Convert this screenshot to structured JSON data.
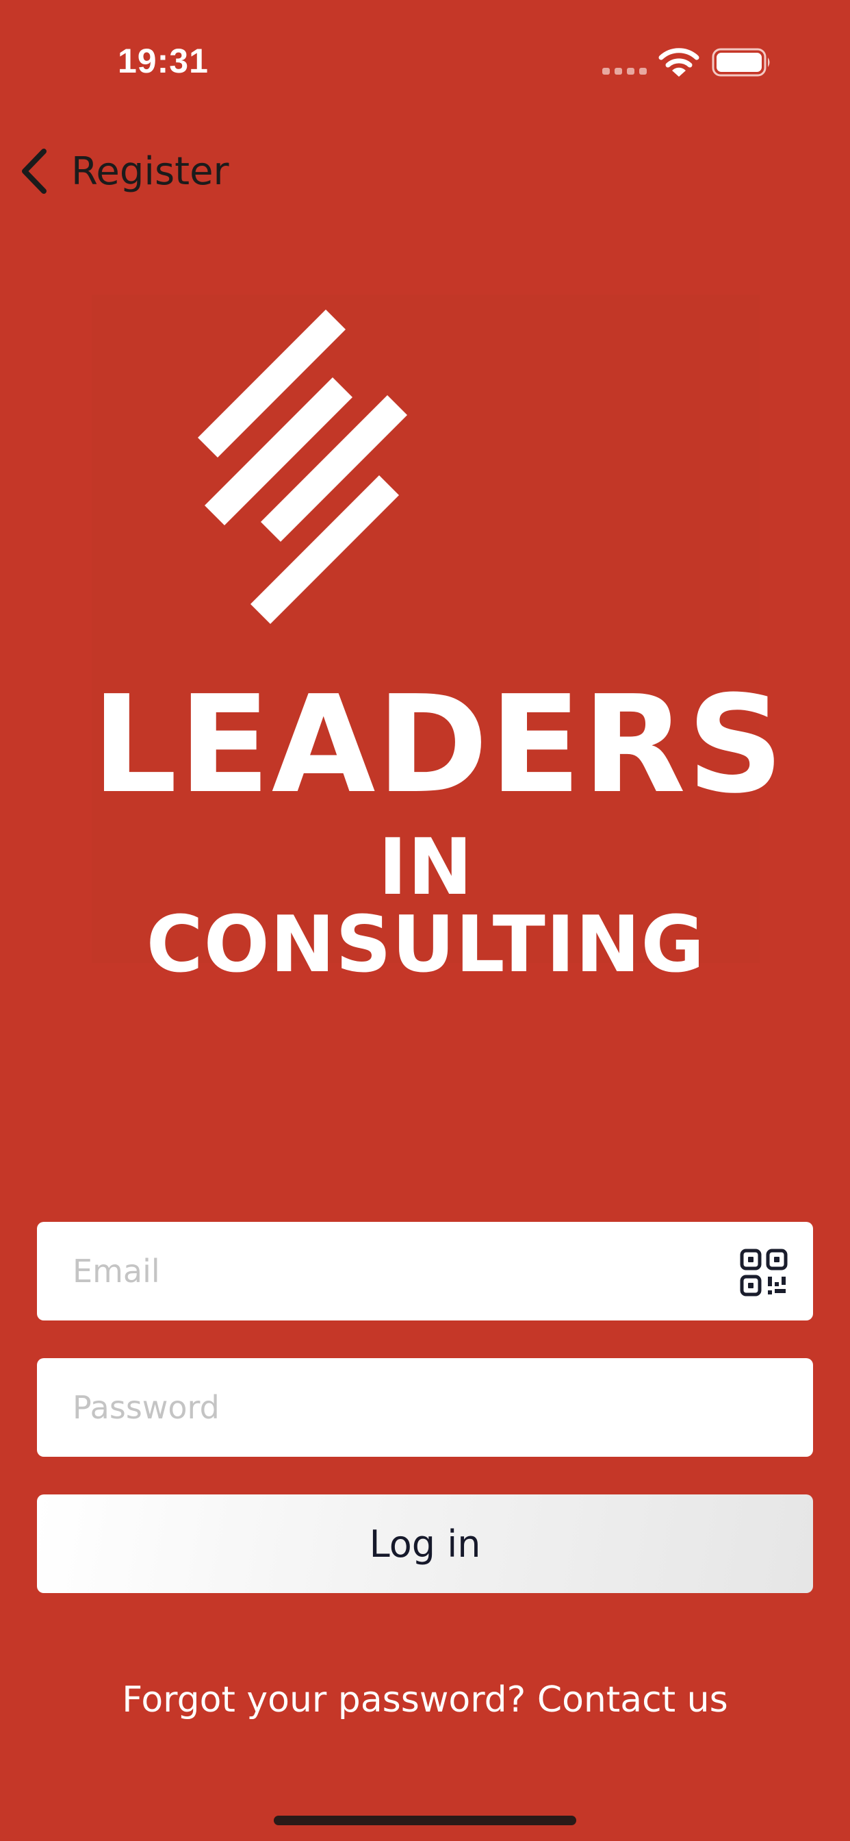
{
  "status_bar": {
    "time": "19:31",
    "icons": [
      "cellular-dots-icon",
      "wifi-icon",
      "battery-icon"
    ]
  },
  "nav": {
    "back_label": "Register",
    "back_icon": "chevron-left-icon"
  },
  "logo": {
    "line1": "LEADERS",
    "line2": "IN CONSULTING",
    "mark_icon": "stripes-logo-icon"
  },
  "form": {
    "email_placeholder": "Email",
    "email_value": "",
    "password_placeholder": "Password",
    "password_value": "",
    "qr_icon": "qr-code-icon",
    "login_label": "Log in"
  },
  "footer": {
    "forgot_text": "Forgot your password? Contact us"
  },
  "colors": {
    "background": "#C53728",
    "logo_background": "#C23727",
    "text_on_red": "#FFFFFF",
    "field_background": "#FFFFFF",
    "placeholder": "#C4C4C4",
    "button_text": "#16192B"
  }
}
